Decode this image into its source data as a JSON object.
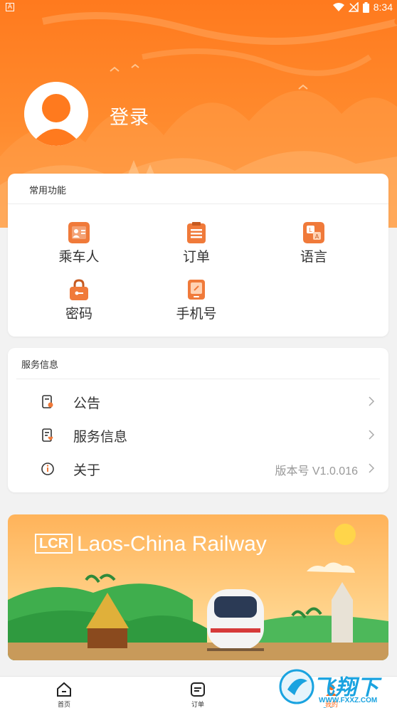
{
  "status_bar": {
    "app_icon_letter": "A",
    "time": "8:34"
  },
  "header": {
    "login_label": "登录"
  },
  "common_functions": {
    "title": "常用功能",
    "items": [
      {
        "label": "乘车人",
        "icon": "passenger-icon"
      },
      {
        "label": "订单",
        "icon": "order-icon"
      },
      {
        "label": "语言",
        "icon": "language-icon"
      },
      {
        "label": "密码",
        "icon": "password-icon"
      },
      {
        "label": "手机号",
        "icon": "phone-icon"
      }
    ]
  },
  "service_info": {
    "title": "服务信息",
    "rows": [
      {
        "label": "公告",
        "icon": "announcement-icon"
      },
      {
        "label": "服务信息",
        "icon": "service-info-icon"
      },
      {
        "label": "关于",
        "icon": "about-icon",
        "value": "版本号 V1.0.016"
      }
    ]
  },
  "banner": {
    "logo_text": "LCR",
    "title": "Laos-China Railway"
  },
  "bottom_nav": {
    "items": [
      {
        "label": "首页",
        "icon": "home-icon",
        "active": false
      },
      {
        "label": "订单",
        "icon": "order-list-icon",
        "active": false
      },
      {
        "label": "我的",
        "icon": "profile-icon",
        "active": true
      }
    ]
  },
  "watermark": {
    "text": "飞翔下载",
    "url": "WWW.FXXZ.COM"
  },
  "colors": {
    "accent": "#ff7a1e",
    "icon_orange": "#f07a3a",
    "active_nav": "#ff6a1a"
  }
}
